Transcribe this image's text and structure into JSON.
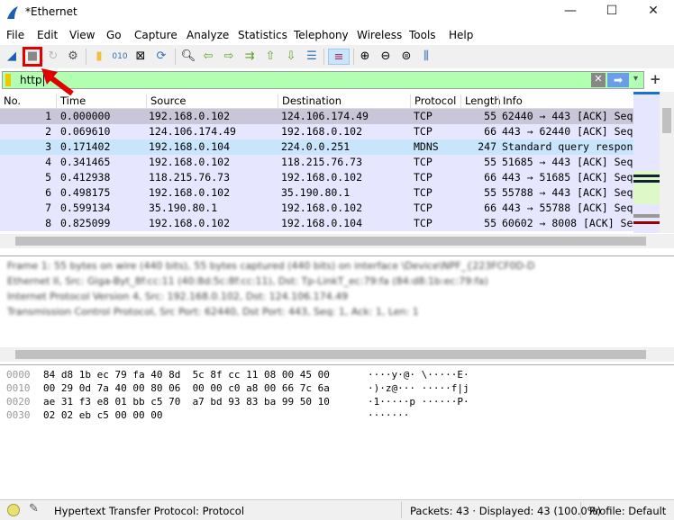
{
  "window": {
    "title": "*Ethernet",
    "minimize": "—",
    "maximize": "☐",
    "close": "✕"
  },
  "menu": [
    "File",
    "Edit",
    "View",
    "Go",
    "Capture",
    "Analyze",
    "Statistics",
    "Telephony",
    "Wireless",
    "Tools",
    "Help"
  ],
  "toolbar": [
    "start-capture",
    "stop-capture",
    "restart-capture",
    "capture-options",
    "open-file",
    "save-file",
    "close-file",
    "reload-file",
    "find-packet",
    "go-back",
    "go-forward",
    "go-to-packet",
    "go-first",
    "go-last",
    "auto-scroll",
    "colorize",
    "zoom-in",
    "zoom-out",
    "zoom-normal",
    "resize-columns"
  ],
  "filter": {
    "value": "http",
    "clear": "✕",
    "apply": "➡",
    "dropdown": "▾",
    "add": "+"
  },
  "packet_list": {
    "columns": [
      "No.",
      "Time",
      "Source",
      "Destination",
      "Protocol",
      "Length",
      "Info"
    ],
    "rows": [
      {
        "no": "1",
        "time": "0.000000",
        "src": "192.168.0.102",
        "dst": "124.106.174.49",
        "proto": "TCP",
        "len": "55",
        "info": "62440 → 443 [ACK] Seq"
      },
      {
        "no": "2",
        "time": "0.069610",
        "src": "124.106.174.49",
        "dst": "192.168.0.102",
        "proto": "TCP",
        "len": "66",
        "info": "443 → 62440 [ACK] Seq"
      },
      {
        "no": "3",
        "time": "0.171402",
        "src": "192.168.0.104",
        "dst": "224.0.0.251",
        "proto": "MDNS",
        "len": "247",
        "info": "Standard query respon"
      },
      {
        "no": "4",
        "time": "0.341465",
        "src": "192.168.0.102",
        "dst": "118.215.76.73",
        "proto": "TCP",
        "len": "55",
        "info": "51685 → 443 [ACK] Seq"
      },
      {
        "no": "5",
        "time": "0.412938",
        "src": "118.215.76.73",
        "dst": "192.168.0.102",
        "proto": "TCP",
        "len": "66",
        "info": "443 → 51685 [ACK] Seq"
      },
      {
        "no": "6",
        "time": "0.498175",
        "src": "192.168.0.102",
        "dst": "35.190.80.1",
        "proto": "TCP",
        "len": "55",
        "info": "55788 → 443 [ACK] Seq"
      },
      {
        "no": "7",
        "time": "0.599134",
        "src": "35.190.80.1",
        "dst": "192.168.0.102",
        "proto": "TCP",
        "len": "66",
        "info": "443 → 55788 [ACK] Seq"
      },
      {
        "no": "8",
        "time": "0.825099",
        "src": "192.168.0.102",
        "dst": "192.168.0.104",
        "proto": "TCP",
        "len": "55",
        "info": "60602 → 8008 [ACK] Se"
      }
    ]
  },
  "details": [
    "Frame 1: 55 bytes on wire (440 bits), 55 bytes captured (440 bits) on interface \\Device\\NPF_{223FCF0D-D",
    "Ethernet II, Src: Giga-Byt_8f:cc:11 (40:8d:5c:8f:cc:11), Dst: Tp-LinkT_ec:79:fa (84:d8:1b:ec:79:fa)",
    "Internet Protocol Version 4, Src: 192.168.0.102, Dst: 124.106.174.49",
    "Transmission Control Protocol, Src Port: 62440, Dst Port: 443, Seq: 1, Ack: 1, Len: 1"
  ],
  "bytes": [
    {
      "offset": "0000",
      "hex": "84 d8 1b ec 79 fa 40 8d  5c 8f cc 11 08 00 45 00",
      "ascii": "····y·@· \\·····E·"
    },
    {
      "offset": "0010",
      "hex": "00 29 0d 7a 40 00 80 06  00 00 c0 a8 00 66 7c 6a",
      "ascii": "·)·z@··· ·····f|j"
    },
    {
      "offset": "0020",
      "hex": "ae 31 f3 e8 01 bb c5 70  a7 bd 93 83 ba 99 50 10",
      "ascii": "·1·····p ······P·"
    },
    {
      "offset": "0030",
      "hex": "02 02 eb c5 00 00 00",
      "ascii": "·······"
    }
  ],
  "status": {
    "field": "Hypertext Transfer Protocol: Protocol",
    "packets": "Packets: 43 · Displayed: 43 (100.0%)",
    "profile": "Profile: Default"
  },
  "colors": {
    "filter_ok": "#b2ffb2",
    "tcp_row": "#e7e6ff",
    "mdns_row": "#c9e5fb",
    "selected_row": "#c8c6d8",
    "highlight": "#e00000"
  }
}
